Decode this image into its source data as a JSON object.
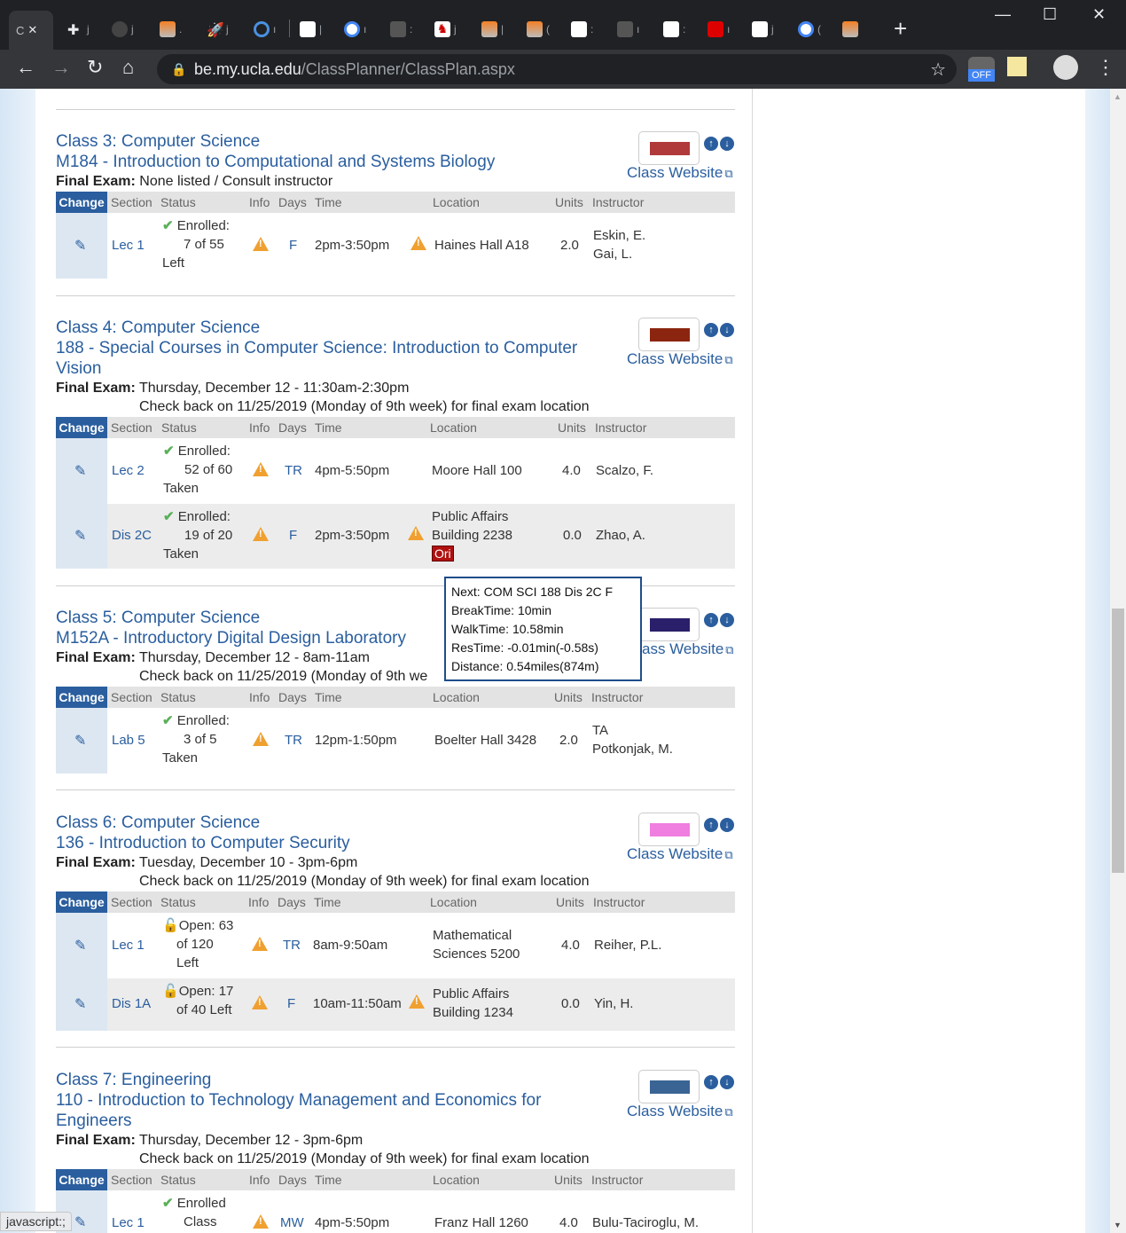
{
  "browser": {
    "active_tab_label": "C",
    "url_host": "be.my.ucla.edu",
    "url_path": "/ClassPlanner/ClassPlan.aspx",
    "ext_off_label": "OFF",
    "tab_labels": [
      "j",
      "j",
      ".",
      "j",
      "ı",
      "|",
      "ı",
      ":",
      "j",
      "|",
      "(",
      ":",
      "ı",
      ":",
      "ı",
      "j",
      "("
    ]
  },
  "status_bar": "javascript:;",
  "table_headers": {
    "change": "Change",
    "section": "Section",
    "status": "Status",
    "info": "Info",
    "days": "Days",
    "time": "Time",
    "location": "Location",
    "units": "Units",
    "instructor": "Instructor"
  },
  "website_label": "Class Website",
  "final_exam_label": "Final Exam:",
  "classes": [
    {
      "heading": "Class 3: Computer Science",
      "course": "M184 - Introduction to Computational and Systems Biology",
      "final_exam": "None listed / Consult instructor",
      "check_back": "",
      "color": "#b03a3a",
      "rows": [
        {
          "section": "Lec 1",
          "status_icon": "check-icon",
          "status_line1": "Enrolled:",
          "status_line2": "7 of 55",
          "status_line3": "Left",
          "days": "F",
          "time": "2pm-3:50pm",
          "location_line1": "Haines Hall A18",
          "location_line2": "",
          "units": "2.0",
          "instructor_line1": "Eskin, E.",
          "instructor_line2": "Gai, L."
        }
      ]
    },
    {
      "heading": "Class 4: Computer Science",
      "course": "188 - Special Courses in Computer Science: Introduction to Computer Vision",
      "final_exam": "Thursday, December 12 - 11:30am-2:30pm",
      "check_back": "Check back on 11/25/2019 (Monday of 9th week) for final exam location",
      "color": "#8b2510",
      "rows": [
        {
          "section": "Lec 2",
          "status_icon": "check-icon",
          "status_line1": "Enrolled:",
          "status_line2": "52 of 60",
          "status_line3": "Taken",
          "days": "TR",
          "time": "4pm-5:50pm",
          "location_line1": "Moore Hall 100",
          "location_line2": "",
          "units": "4.0",
          "instructor_line1": "Scalzo, F.",
          "instructor_line2": ""
        },
        {
          "section": "Dis 2C",
          "status_icon": "check-icon",
          "status_line1": "Enrolled:",
          "status_line2": "19 of 20",
          "status_line3": "Taken",
          "days": "F",
          "time": "2pm-3:50pm",
          "location_line1": "Public Affairs",
          "location_line2": "Building 2238",
          "location_badge": "Ori",
          "units": "0.0",
          "instructor_line1": "Zhao, A.",
          "instructor_line2": ""
        }
      ]
    },
    {
      "heading": "Class 5: Computer Science",
      "course": "M152A - Introductory Digital Design Laboratory",
      "final_exam": "Thursday, December 12 - 8am-11am",
      "check_back": "Check back on 11/25/2019 (Monday of 9th we",
      "website_visible": "ass Website",
      "color": "#2a1f6a",
      "rows": [
        {
          "section": "Lab 5",
          "status_icon": "check-icon",
          "status_line1": "Enrolled:",
          "status_line2": "3 of 5",
          "status_line3": "Taken",
          "days": "TR",
          "time": "12pm-1:50pm",
          "location_line1": "Boelter Hall 3428",
          "location_line2": "",
          "units": "2.0",
          "instructor_line1": "TA",
          "instructor_line2": "Potkonjak, M."
        }
      ]
    },
    {
      "heading": "Class 6: Computer Science",
      "course": "136 - Introduction to Computer Security",
      "final_exam": "Tuesday, December 10 - 3pm-6pm",
      "check_back": "Check back on 11/25/2019 (Monday of 9th week) for final exam location",
      "color": "#ef7ee0",
      "rows": [
        {
          "section": "Lec 1",
          "status_icon": "lock-open-icon",
          "status_line1": "Open: 63",
          "status_line2": "of 120",
          "status_line3": "Left",
          "days": "TR",
          "time": "8am-9:50am",
          "location_line1": "Mathematical",
          "location_line2": "Sciences 5200",
          "units": "4.0",
          "instructor_line1": "Reiher, P.L.",
          "instructor_line2": ""
        },
        {
          "section": "Dis 1A",
          "status_icon": "lock-open-icon",
          "status_line1": "Open: 17",
          "status_line2": "of 40 Left",
          "status_line3": "",
          "days": "F",
          "time": "10am-11:50am",
          "location_line1": "Public Affairs",
          "location_line2": "Building 1234",
          "units": "0.0",
          "instructor_line1": "Yin, H.",
          "instructor_line2": ""
        }
      ]
    },
    {
      "heading": "Class 7: Engineering",
      "course": "110 - Introduction to Technology Management and Economics for Engineers",
      "final_exam": "Thursday, December 12 - 3pm-6pm",
      "check_back": "Check back on 11/25/2019 (Monday of 9th week) for final exam location",
      "color": "#3a6494",
      "rows": [
        {
          "section": "Lec 1",
          "status_icon": "check-icon",
          "status_line1": "Enrolled",
          "status_line2": "Class",
          "status_line3": "",
          "days": "MW",
          "time": "4pm-5:50pm",
          "location_line1": "Franz Hall 1260",
          "location_line2": "",
          "units": "4.0",
          "instructor_line1": "Bulu-Taciroglu, M.",
          "instructor_line2": ""
        }
      ]
    }
  ],
  "tooltip": {
    "next": "Next: COM SCI 188 Dis 2C F",
    "break_time": "BreakTime: 10min",
    "walk_time": "WalkTime: 10.58min",
    "res_time": "ResTime: -0.01min(-0.58s)",
    "distance": "Distance: 0.54miles(874m)"
  }
}
